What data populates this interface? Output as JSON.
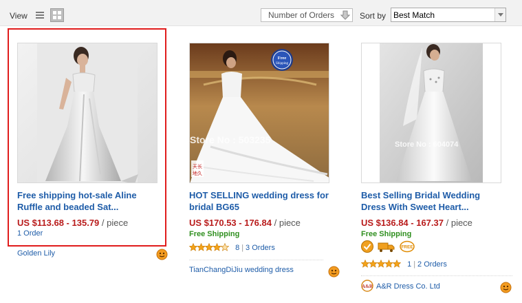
{
  "toolbar": {
    "view_label": "View",
    "list_view_icon": "list-view-icon",
    "grid_view_icon": "grid-view-icon",
    "orders_sort_label": "Number of Orders",
    "sort_by_label": "Sort by",
    "sort_by_value": "Best Match"
  },
  "products": [
    {
      "title_line1": "Free shipping hot-sale Aline",
      "title_line2": "Ruffle and beaded Sat...",
      "price": "US $113.68 - 135.79",
      "unit": "/ piece",
      "orders": "1 Order",
      "seller": "Golden Lily",
      "highlighted": true
    },
    {
      "title_line1": "HOT SELLING wedding dress for",
      "title_line2": "bridal BG65",
      "price": "US $170.53 - 176.84",
      "unit": "/ piece",
      "shipping": "Free Shipping",
      "feedback_count": "8",
      "orders": "3 Orders",
      "seller": "TianChangDiJiu wedding dress",
      "image_watermark": "Store No : 503235",
      "image_badge": "Free Shipping",
      "image_stamp": "天长地久"
    },
    {
      "title_line1": "Best Selling Bridal Wedding",
      "title_line2": "Dress With Sweet Heart...",
      "price": "US $136.84 - 167.37",
      "unit": "/ piece",
      "shipping": "Free Shipping",
      "feedback_count": "1",
      "orders": "2 Orders",
      "seller": "A&R Dress Co. Ltd",
      "image_watermark": "Store No : 604074",
      "seller_logo": "A&R"
    }
  ],
  "colors": {
    "link": "#1e5ca8",
    "price": "#b91c1c",
    "free_shipping": "#2f8f1f",
    "highlight": "#e01b1b"
  }
}
